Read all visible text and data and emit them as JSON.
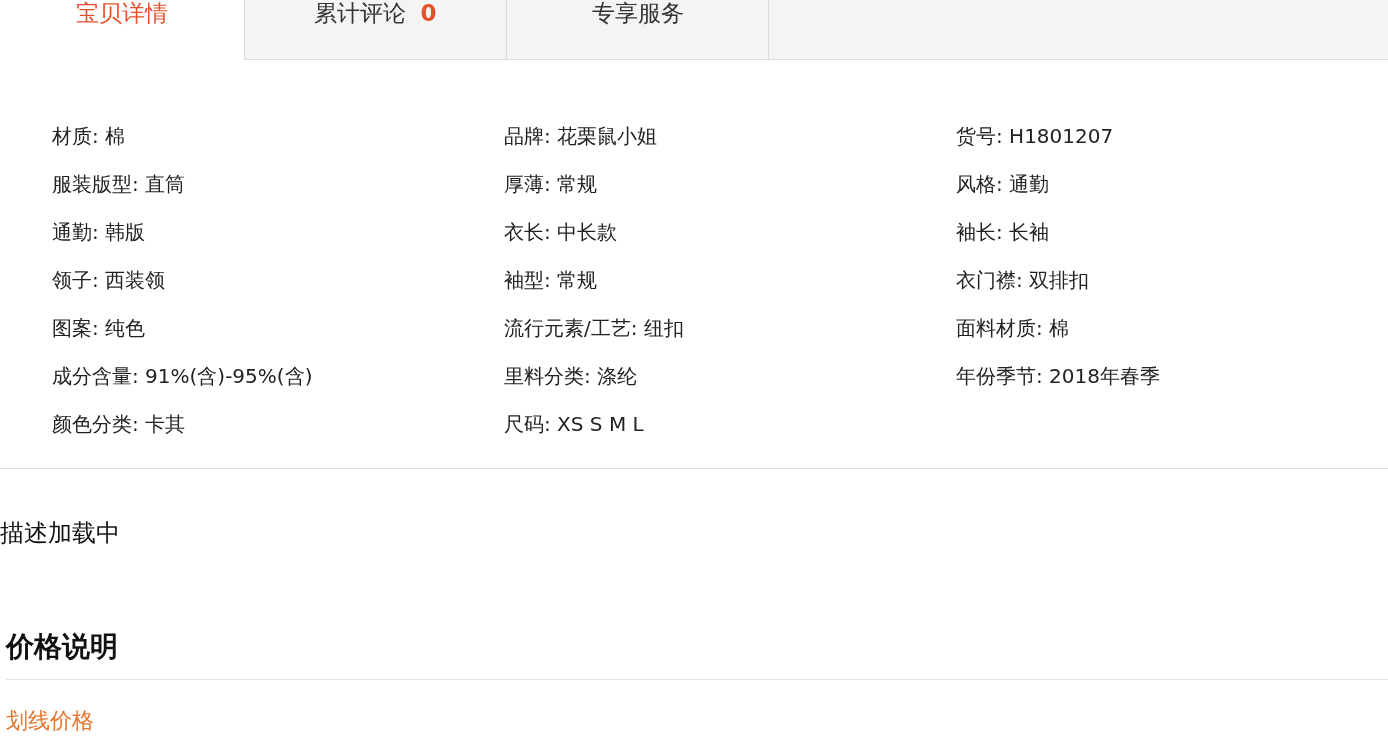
{
  "tabs": [
    {
      "label": "宝贝详情",
      "selected": true
    },
    {
      "label": "累计评论",
      "count": "0",
      "selected": false
    },
    {
      "label": "专享服务",
      "selected": false
    }
  ],
  "attributes": [
    {
      "text": "材质: 棉"
    },
    {
      "text": "品牌: 花栗鼠小姐"
    },
    {
      "text": "货号: H1801207"
    },
    {
      "text": "服装版型: 直筒"
    },
    {
      "text": "厚薄: 常规"
    },
    {
      "text": "风格: 通勤"
    },
    {
      "text": "通勤: 韩版"
    },
    {
      "text": "衣长: 中长款"
    },
    {
      "text": "袖长: 长袖"
    },
    {
      "text": "领子: 西装领"
    },
    {
      "text": "袖型: 常规"
    },
    {
      "text": "衣门襟: 双排扣"
    },
    {
      "text": "图案: 纯色"
    },
    {
      "text": "流行元素/工艺: 纽扣"
    },
    {
      "text": "面料材质: 棉"
    },
    {
      "text": "成分含量: 91%(含)-95%(含)"
    },
    {
      "text": "里料分类: 涤纶"
    },
    {
      "text": "年份季节: 2018年春季"
    },
    {
      "text": "颜色分类: 卡其"
    },
    {
      "text": "尺码: XS S M L"
    }
  ],
  "description_status": "描述加载中",
  "price_section": {
    "title": "价格说明",
    "subtitle": "划线价格"
  }
}
